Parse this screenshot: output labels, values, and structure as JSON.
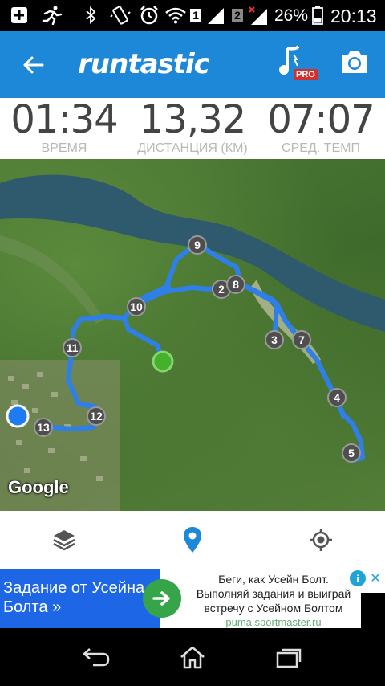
{
  "status_bar": {
    "battery_percent": "26%",
    "time": "20:13",
    "sim1": "1",
    "sim2": "2",
    "icons": [
      "add-box-icon",
      "runner-icon",
      "bluetooth-icon",
      "vibrate-icon",
      "alarm-icon",
      "wifi-icon",
      "signal-sim1-icon",
      "signal-sim2-icon",
      "battery-icon"
    ]
  },
  "app_bar": {
    "logo_text": "runtastic",
    "pro_badge": "PRO",
    "color": "#1e88d8"
  },
  "stats": [
    {
      "value": "01:34",
      "label": "ВРЕМЯ"
    },
    {
      "value": "13,32",
      "label": "ДИСТАНЦИЯ (КМ)"
    },
    {
      "value": "07:07",
      "label": "СРЕД. ТЕМП"
    }
  ],
  "map": {
    "attribution": "Google",
    "km_markers": [
      "2",
      "3",
      "4",
      "5",
      "7",
      "8",
      "9",
      "10",
      "11",
      "12",
      "13"
    ],
    "route_color": "#2f7fe8",
    "start_color": "#44b02c",
    "current_color": "#1e7cf2"
  },
  "controls": {
    "icons": [
      "layers-icon",
      "location-pin-icon",
      "gps-target-icon"
    ],
    "active_color": "#1e88d8"
  },
  "ad": {
    "left_text": "Задание от Усейна Болта »",
    "body_line1": "Беги, как Усейн Болт.",
    "body_line2": "Выполняй задания и выиграй",
    "body_line3": "встречу с Усейном Болтом",
    "url": "puma.sportmaster.ru",
    "info": "i",
    "close": "✕"
  },
  "nav": {
    "icons": [
      "back-icon",
      "home-icon",
      "recents-icon"
    ]
  }
}
